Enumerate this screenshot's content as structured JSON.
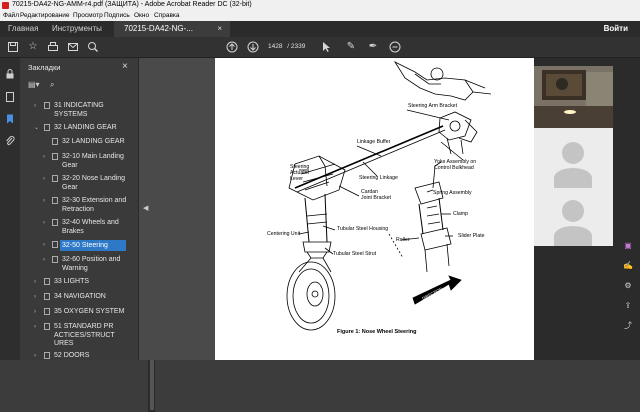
{
  "window": {
    "title": "70215-DA42-NG-AMM-r4.pdf (ЗАЩИТА) - Adobe Acrobat Reader DC (32-bit)"
  },
  "menu": [
    "Файл",
    "Редактирование",
    "Просмотр",
    "Подпись",
    "Окно",
    "Справка"
  ],
  "tabs": {
    "home": "Главная",
    "tools": "Инструменты",
    "doc": "70215-DA42-NG-...",
    "close": "×"
  },
  "signin": "Войти",
  "toolbar": {
    "page_current": "1428",
    "page_total": "/ 2339"
  },
  "bookmarks": {
    "title": "Закладки",
    "close": "×",
    "items": [
      {
        "label": "31 INDICATING SYSTEMS"
      },
      {
        "label": "32 LANDING GEAR"
      },
      {
        "label": "32 LANDING GEAR"
      },
      {
        "label": "32-10 Main Landing Gear"
      },
      {
        "label": "32-20 Nose Landing Gear"
      },
      {
        "label": "32-30 Extension and Retraction"
      },
      {
        "label": "32-40 Wheels and Brakes"
      },
      {
        "label": "32-50 Steering"
      },
      {
        "label": "32-60 Position and Warning"
      },
      {
        "label": "33 LIGHTS"
      },
      {
        "label": "34 NAVIGATION"
      },
      {
        "label": "35 OXYGEN SYSTEM"
      },
      {
        "label": "51 STANDARD PRACTICES/STRUCTURES"
      },
      {
        "label": "52 DOORS"
      }
    ]
  },
  "figure": {
    "labels": {
      "steering_arm_bracket": "Steering Arm Bracket",
      "linkage_buffer": "Linkage Buffer",
      "yoke_assembly": "Yoke Assembly on",
      "control_bulkhead": "Control Bulkhead",
      "steering_actuator": "Steering",
      "actuator": "Actuator",
      "lever": "Lever",
      "steering_linkage": "Steering Linkage",
      "cardan": "Cardan",
      "joint_bracket": "Joint Bracket",
      "spring_assembly": "Spring Assembly",
      "clamp": "Clamp",
      "tubular_steel_housing": "Tubular Steel Housing",
      "centering_unit": "Centering Unit",
      "roller": "Roller",
      "slider_plate": "Slider Plate",
      "tubular_steel_strut": "Tubular Steel Strut",
      "direction": "DIRECTION",
      "of_flight": "OF FLIGHT"
    },
    "caption": "Figure 1: Nose Wheel Steering"
  }
}
